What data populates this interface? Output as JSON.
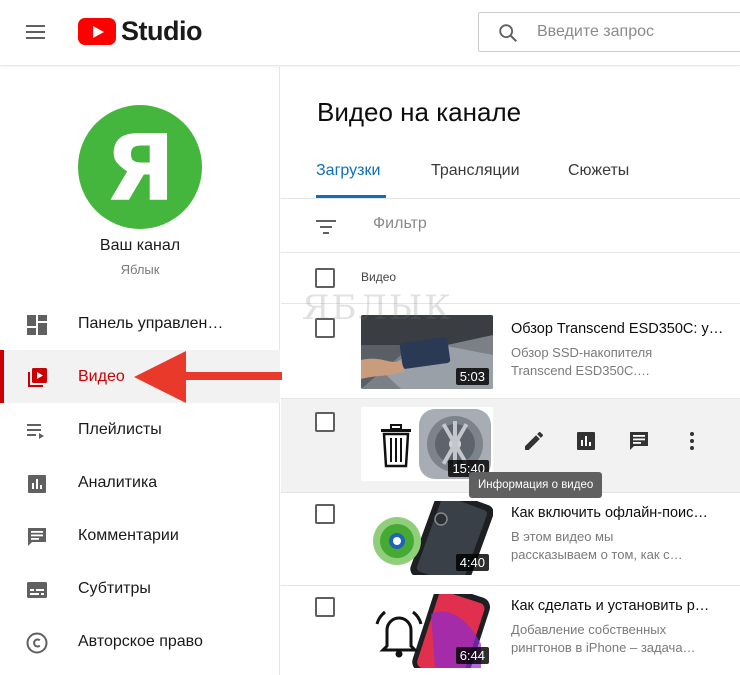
{
  "header": {
    "logo_text": "Studio",
    "search_placeholder": "Введите запрос"
  },
  "sidebar": {
    "avatar_letter": "Я",
    "channel_name": "Ваш канал",
    "channel_sub": "Яблык",
    "items": [
      {
        "label": "Панель управлен…",
        "icon": "dashboard-icon"
      },
      {
        "label": "Видео",
        "icon": "video-library-icon",
        "active": true
      },
      {
        "label": "Плейлисты",
        "icon": "playlist-icon"
      },
      {
        "label": "Аналитика",
        "icon": "analytics-icon"
      },
      {
        "label": "Комментарии",
        "icon": "comments-icon"
      },
      {
        "label": "Субтитры",
        "icon": "subtitles-icon"
      },
      {
        "label": "Авторское право",
        "icon": "copyright-icon"
      }
    ]
  },
  "main": {
    "title": "Видео на канале",
    "tabs": [
      {
        "label": "Загрузки",
        "active": true
      },
      {
        "label": "Трансляции"
      },
      {
        "label": "Сюжеты"
      }
    ],
    "filter_placeholder": "Фильтр",
    "column_header": "Видео",
    "watermark": "ЯБЛЫК",
    "tooltip": "Информация о видео",
    "videos": [
      {
        "title": "Обзор Transcend ESD350C: у…",
        "desc_line1": "Обзор SSD-накопителя",
        "desc_line2": "Transcend ESD350C.…",
        "duration": "5:03"
      },
      {
        "title": "",
        "desc_line1": "",
        "desc_line2": "",
        "duration": "15:40",
        "hovered": true
      },
      {
        "title": "Как включить офлайн-поис…",
        "desc_line1": "В этом видео мы",
        "desc_line2": "рассказываем о том, как с…",
        "duration": "4:40"
      },
      {
        "title": "Как сделать и установить р…",
        "desc_line1": "Добавление собственных",
        "desc_line2": "рингтонов в iPhone – задача…",
        "duration": "6:44"
      }
    ]
  },
  "colors": {
    "brand_red": "#ff0000",
    "active_red": "#cc0000",
    "tab_blue": "#0f6fb8",
    "avatar_green": "#44b53d",
    "arrow_red": "#e8392b"
  }
}
